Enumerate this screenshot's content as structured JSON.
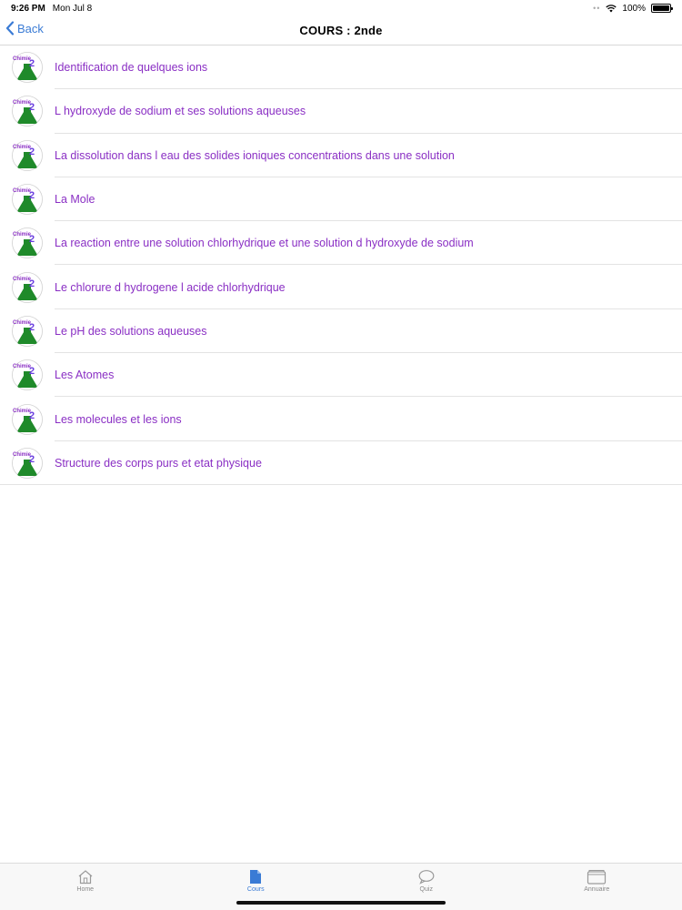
{
  "status_bar": {
    "time": "9:26 PM",
    "date": "Mon Jul 8",
    "battery": "100%"
  },
  "nav": {
    "back_label": "Back",
    "title": "COURS : 2nde"
  },
  "list": {
    "icon_text": "Chimie",
    "icon_number": "2",
    "items": [
      {
        "label": "Identification de quelques ions"
      },
      {
        "label": "L hydroxyde de sodium et ses solutions aqueuses"
      },
      {
        "label": "La dissolution dans l eau des solides ioniques concentrations dans une solution"
      },
      {
        "label": "La Mole"
      },
      {
        "label": "La reaction entre une solution chlorhydrique et une solution d hydroxyde de sodium"
      },
      {
        "label": "Le chlorure d hydrogene l acide chlorhydrique"
      },
      {
        "label": "Le pH des solutions aqueuses"
      },
      {
        "label": "Les Atomes"
      },
      {
        "label": "Les molecules et les ions"
      },
      {
        "label": "Structure des corps purs et etat physique"
      }
    ]
  },
  "tabs": [
    {
      "label": "Home",
      "icon": "home-icon",
      "active": false
    },
    {
      "label": "Cours",
      "icon": "document-icon",
      "active": true
    },
    {
      "label": "Quiz",
      "icon": "speech-bubble-icon",
      "active": false
    },
    {
      "label": "Annuaire",
      "icon": "folder-icon",
      "active": false
    }
  ],
  "colors": {
    "accent": "#3a7bd5",
    "item_text": "#8a2fc4",
    "flask_green": "#1f8a2a"
  }
}
